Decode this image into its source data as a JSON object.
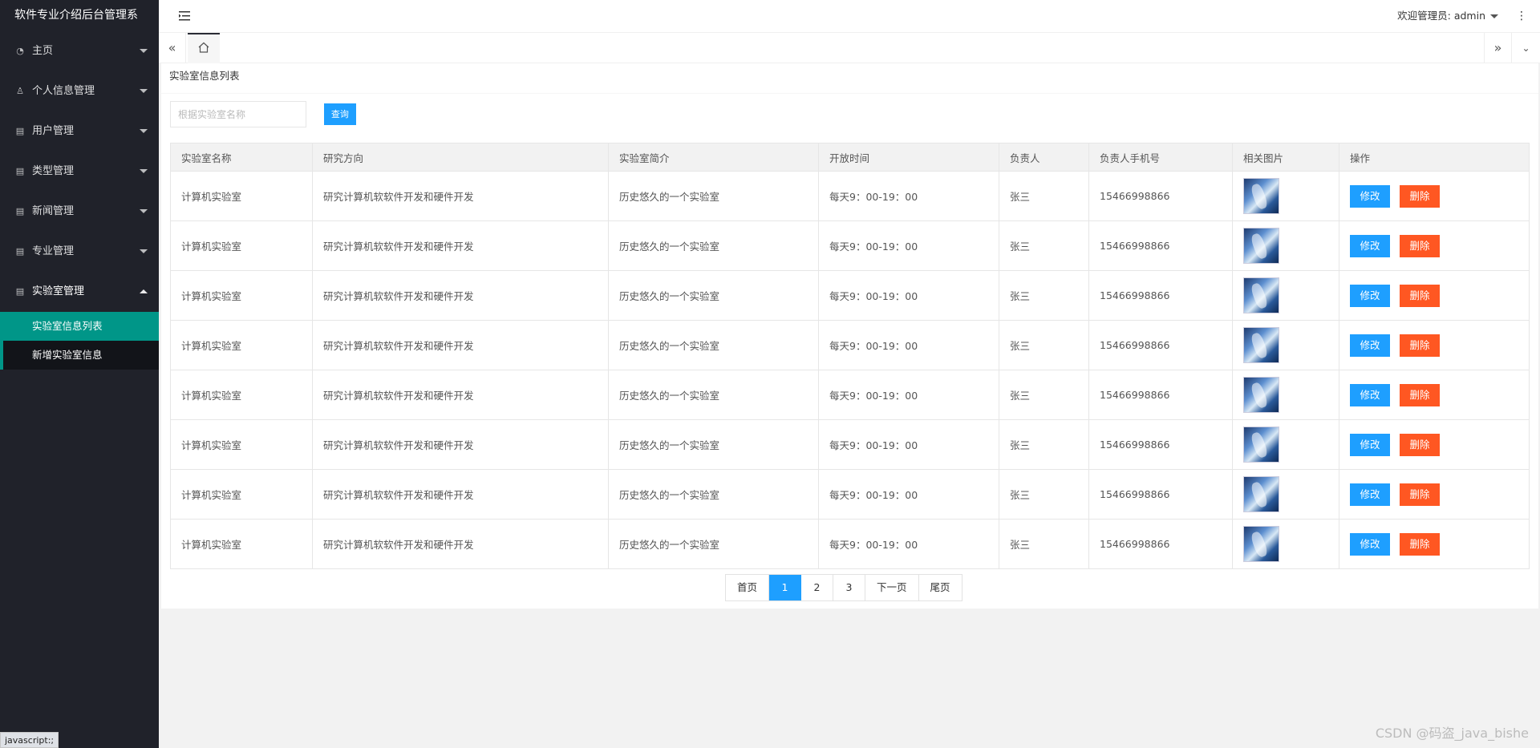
{
  "app": {
    "title": "软件专业介绍后台管理系"
  },
  "sidebar": {
    "items": [
      {
        "label": "主页",
        "icon": "dashboard-icon"
      },
      {
        "label": "个人信息管理",
        "icon": "user-icon"
      },
      {
        "label": "用户管理",
        "icon": "file-icon"
      },
      {
        "label": "类型管理",
        "icon": "file-icon"
      },
      {
        "label": "新闻管理",
        "icon": "file-icon"
      },
      {
        "label": "专业管理",
        "icon": "file-icon"
      },
      {
        "label": "实验室管理",
        "icon": "file-icon"
      }
    ],
    "submenu": [
      {
        "label": "实验室信息列表",
        "active": true
      },
      {
        "label": "新增实验室信息",
        "active": false
      }
    ]
  },
  "header": {
    "admin_label": "欢迎管理员: admin"
  },
  "status_bar": {
    "text": "javascript:;"
  },
  "page": {
    "title": "实验室信息列表",
    "search": {
      "placeholder": "根据实验室名称",
      "value": "",
      "button": "查询"
    }
  },
  "table": {
    "columns": [
      "实验室名称",
      "研究方向",
      "实验室简介",
      "开放时间",
      "负责人",
      "负责人手机号",
      "相关图片",
      "操作"
    ],
    "rows": [
      {
        "name": "计算机实验室",
        "direction": "研究计算机软软件开发和硬件开发",
        "intro": "历史悠久的一个实验室",
        "open_time": "每天9：00-19：00",
        "owner": "张三",
        "phone": "15466998866"
      },
      {
        "name": "计算机实验室",
        "direction": "研究计算机软软件开发和硬件开发",
        "intro": "历史悠久的一个实验室",
        "open_time": "每天9：00-19：00",
        "owner": "张三",
        "phone": "15466998866"
      },
      {
        "name": "计算机实验室",
        "direction": "研究计算机软软件开发和硬件开发",
        "intro": "历史悠久的一个实验室",
        "open_time": "每天9：00-19：00",
        "owner": "张三",
        "phone": "15466998866"
      },
      {
        "name": "计算机实验室",
        "direction": "研究计算机软软件开发和硬件开发",
        "intro": "历史悠久的一个实验室",
        "open_time": "每天9：00-19：00",
        "owner": "张三",
        "phone": "15466998866"
      },
      {
        "name": "计算机实验室",
        "direction": "研究计算机软软件开发和硬件开发",
        "intro": "历史悠久的一个实验室",
        "open_time": "每天9：00-19：00",
        "owner": "张三",
        "phone": "15466998866"
      },
      {
        "name": "计算机实验室",
        "direction": "研究计算机软软件开发和硬件开发",
        "intro": "历史悠久的一个实验室",
        "open_time": "每天9：00-19：00",
        "owner": "张三",
        "phone": "15466998866"
      },
      {
        "name": "计算机实验室",
        "direction": "研究计算机软软件开发和硬件开发",
        "intro": "历史悠久的一个实验室",
        "open_time": "每天9：00-19：00",
        "owner": "张三",
        "phone": "15466998866"
      },
      {
        "name": "计算机实验室",
        "direction": "研究计算机软软件开发和硬件开发",
        "intro": "历史悠久的一个实验室",
        "open_time": "每天9：00-19：00",
        "owner": "张三",
        "phone": "15466998866"
      }
    ],
    "actions": {
      "edit": "修改",
      "delete": "删除"
    }
  },
  "pagination": {
    "first": "首页",
    "pages": [
      "1",
      "2",
      "3"
    ],
    "current": "1",
    "next": "下一页",
    "last": "尾页"
  },
  "watermark": "CSDN @码盗_java_bishe",
  "colors": {
    "sidebar_bg": "#20222a",
    "active_green": "#009688",
    "primary_blue": "#1e9fff",
    "danger_orange": "#ff5722"
  }
}
